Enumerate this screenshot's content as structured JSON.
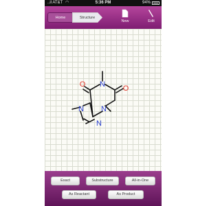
{
  "status_bar": {
    "carrier": "..il AT&T",
    "time": "5:36 PM",
    "battery": "94%"
  },
  "toolbar": {
    "breadcrumb_home": "Home",
    "breadcrumb_structure": "Structure",
    "new_label": "New",
    "edit_label": "Edit"
  },
  "molecule": {
    "atoms": [
      "O",
      "N",
      "O",
      "N",
      "N",
      "N"
    ]
  },
  "search_buttons": {
    "exact": "Exact",
    "substructure": "Substructure",
    "all_in_one": "All-in-One",
    "as_reactant": "As Reactant",
    "as_product": "As Product"
  },
  "colors": {
    "accent": "#8a2a80",
    "oxygen": "#e33b2e",
    "nitrogen": "#2a3fd0"
  }
}
